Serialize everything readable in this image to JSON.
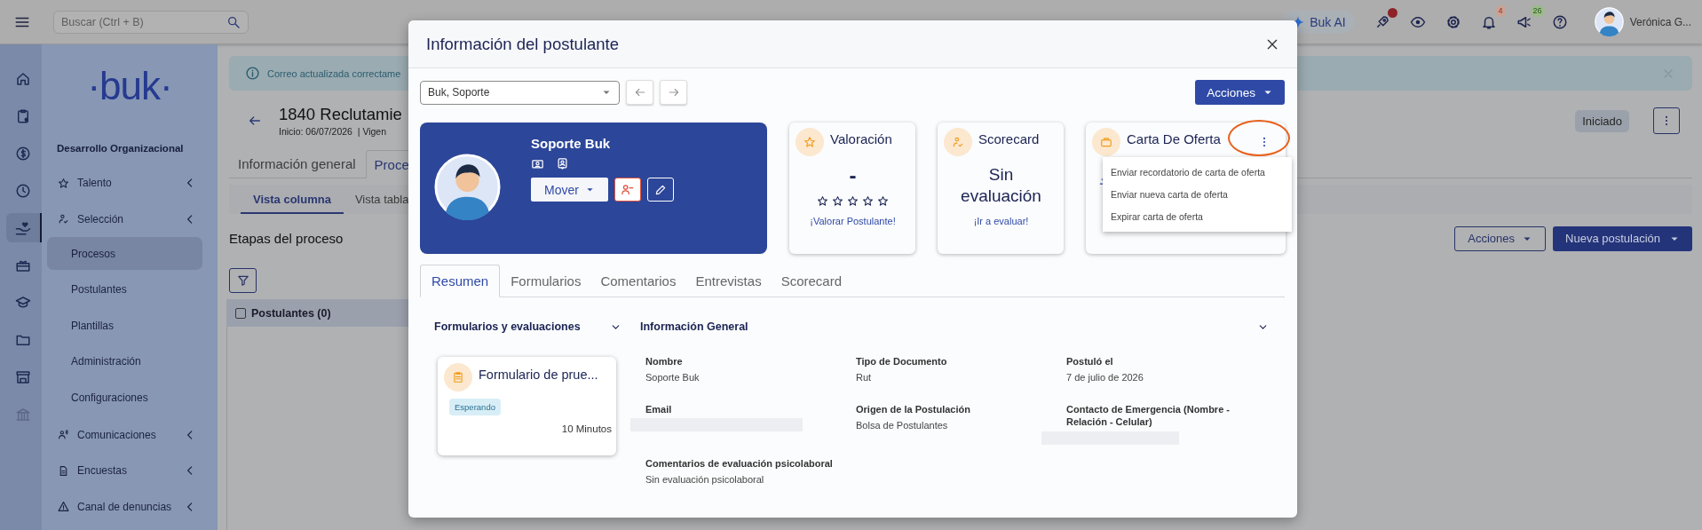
{
  "topbar": {
    "search_placeholder": "Buscar (Ctrl + B)",
    "ai_button": "Buk AI",
    "rocket_dot": true,
    "notifications": "4",
    "announcements": "26",
    "user_name": "Verónica G..."
  },
  "rail": {
    "items": [
      {
        "selected": false,
        "disabled": false
      },
      {
        "selected": false,
        "disabled": false
      },
      {
        "selected": false,
        "disabled": false
      },
      {
        "selected": false,
        "disabled": false
      },
      {
        "selected": true,
        "disabled": false
      },
      {
        "selected": false,
        "disabled": false
      },
      {
        "selected": false,
        "disabled": false
      },
      {
        "selected": false,
        "disabled": false
      },
      {
        "selected": false,
        "disabled": false
      },
      {
        "selected": false,
        "disabled": true
      }
    ]
  },
  "sidebar": {
    "logo": "·buk·",
    "title": "Desarrollo Organizacional",
    "items": [
      {
        "kind": "group",
        "label": "Talento",
        "selected": false
      },
      {
        "kind": "group",
        "label": "Selección",
        "selected": false
      },
      {
        "kind": "link",
        "label": "Procesos",
        "selected": true
      },
      {
        "kind": "link",
        "label": "Postulantes",
        "selected": false
      },
      {
        "kind": "link",
        "label": "Plantillas",
        "selected": false
      },
      {
        "kind": "link",
        "label": "Administración",
        "selected": false
      },
      {
        "kind": "link",
        "label": "Configuraciones",
        "selected": false
      },
      {
        "kind": "group",
        "label": "Comunicaciones",
        "selected": false
      },
      {
        "kind": "group",
        "label": "Encuestas",
        "selected": false
      },
      {
        "kind": "group",
        "label": "Canal de denuncias",
        "selected": false
      }
    ]
  },
  "page": {
    "alert": "Correo actualizada correctame",
    "title": "1840 Reclutamie",
    "subtitle": "Inicio: 06/07/2026  | Vigen",
    "status": "Iniciado",
    "tabs": [
      {
        "label": "Información general",
        "selected": false
      },
      {
        "label": "Proce",
        "selected": true
      }
    ],
    "view_tabs": [
      {
        "label": "Vista columna",
        "selected": true
      },
      {
        "label": "Vista tabla",
        "selected": false
      }
    ],
    "heading": "Etapas del proceso",
    "actions_button": "Acciones",
    "new_button": "Nueva postulación",
    "column_header": {
      "label": "Postulantes (0)",
      "checked": false
    }
  },
  "modal": {
    "title": "Información del postulante",
    "candidate": "Buk, Soporte",
    "actions_button": "Acciones",
    "profile": {
      "name": "Soporte Buk",
      "move_button": "Mover"
    },
    "cards": [
      {
        "kind": "rating",
        "title": "Valoración",
        "value": "-",
        "stars": 0,
        "link": "¡Valorar Postulante!"
      },
      {
        "kind": "scorecard",
        "title": "Scorecard",
        "value": "Sin evaluación",
        "link": "¡Ir a evaluar!"
      },
      {
        "kind": "offer",
        "title": "Carta De Oferta"
      }
    ],
    "menu": {
      "items": [
        "Enviar recordatorio de carta de oferta",
        "Enviar nueva carta de oferta",
        "Expirar carta de oferta"
      ]
    },
    "highlight": true,
    "tabs": [
      {
        "label": "Resumen",
        "selected": true
      },
      {
        "label": "Formularios",
        "selected": false
      },
      {
        "label": "Comentarios",
        "selected": false
      },
      {
        "label": "Entrevistas",
        "selected": false
      },
      {
        "label": "Scorecard",
        "selected": false
      }
    ],
    "forms_section": {
      "title": "Formularios y evaluaciones",
      "forms": [
        {
          "title": "Formulario de prue...",
          "status": "Esperando",
          "duration": "10 Minutos"
        }
      ]
    },
    "info_section": {
      "title": "Información General",
      "fields": [
        {
          "label": "Nombre",
          "value": "Soporte Buk",
          "redacted": false
        },
        {
          "label": "Tipo de Documento",
          "value": "Rut",
          "redacted": false
        },
        {
          "label": "Postuló el",
          "value": "7 de julio de 2026",
          "redacted": false
        },
        {
          "label": "Email",
          "redacted": true
        },
        {
          "label": "Origen de la Postulación",
          "value": "Bolsa de Postulantes",
          "redacted": false
        },
        {
          "label": "Contacto de Emergencia (Nombre - Relación - Celular)",
          "redacted": true
        },
        {
          "label": "Comentarios de evaluación psicolaboral",
          "value": "Sin evaluación psicolaboral",
          "redacted": false
        }
      ]
    }
  }
}
